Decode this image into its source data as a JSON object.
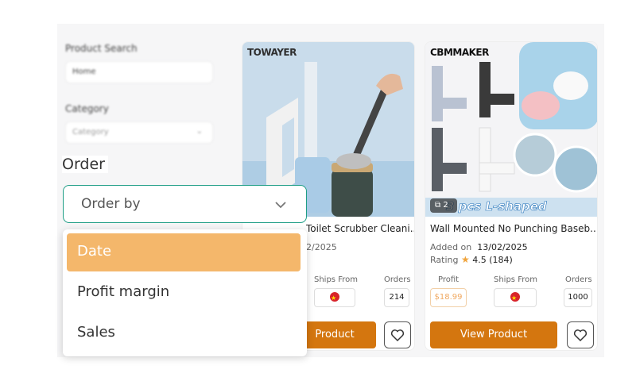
{
  "sidebar": {
    "search_label": "Product Search",
    "search_value": "Home",
    "category_label": "Category",
    "category_placeholder": "Category"
  },
  "order": {
    "label": "Order",
    "placeholder": "Order by",
    "options": [
      "Date",
      "Profit margin",
      "Sales"
    ],
    "highlighted": "Date"
  },
  "cards": [
    {
      "brand": "TOWAYER",
      "title": "Toilet Scrubber Cleani...",
      "added_value": "2/2025",
      "ships_from_label": "Ships From",
      "orders_label": "Orders",
      "orders": "214",
      "cta": "Product"
    },
    {
      "brand": "CBMMAKER",
      "banner": "3 pcs  L-shaped",
      "image_count": "2",
      "title": "Wall Mounted No Punching Baseb...",
      "added_label": "Added on",
      "added_value": "13/02/2025",
      "rating_label": "Rating",
      "rating": "4.5",
      "rating_count": "(184)",
      "profit_label": "Profit",
      "profit": "$18.99",
      "ships_from_label": "Ships From",
      "orders_label": "Orders",
      "orders": "1000",
      "cta": "View Product"
    }
  ],
  "colors": {
    "accent": "#d4760f",
    "highlight": "#f4b76b",
    "select_border": "#1f9e86"
  }
}
